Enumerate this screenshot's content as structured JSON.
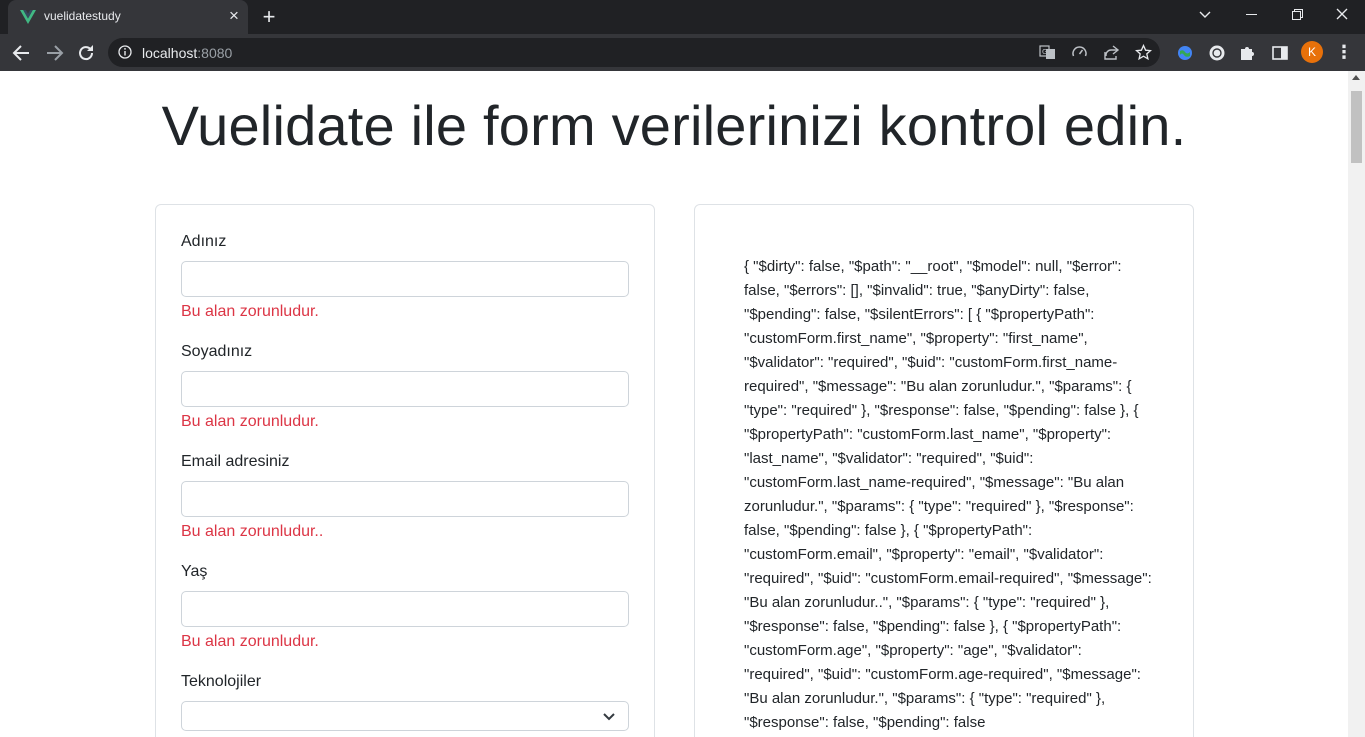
{
  "browser": {
    "tab_title": "vuelidatestudy",
    "url_host": "localhost",
    "url_port": ":8080",
    "profile_initial": "K"
  },
  "page": {
    "heading": "Vuelidate ile form verilerinizi kontrol edin."
  },
  "form": {
    "fields": [
      {
        "label": "Adınız",
        "value": "",
        "error": "Bu alan zorunludur."
      },
      {
        "label": "Soyadınız",
        "value": "",
        "error": "Bu alan zorunludur."
      },
      {
        "label": "Email adresiniz",
        "value": "",
        "error": "Bu alan zorunludur.."
      },
      {
        "label": "Yaş",
        "value": "",
        "error": "Bu alan zorunludur."
      }
    ],
    "tech_label": "Teknolojiler",
    "tech_selected": ""
  },
  "debug_output": "{ \"$dirty\": false, \"$path\": \"__root\", \"$model\": null, \"$error\": false, \"$errors\": [], \"$invalid\": true, \"$anyDirty\": false, \"$pending\": false, \"$silentErrors\": [ { \"$propertyPath\": \"customForm.first_name\", \"$property\": \"first_name\", \"$validator\": \"required\", \"$uid\": \"customForm.first_name-required\", \"$message\": \"Bu alan zorunludur.\", \"$params\": { \"type\": \"required\" }, \"$response\": false, \"$pending\": false }, { \"$propertyPath\": \"customForm.last_name\", \"$property\": \"last_name\", \"$validator\": \"required\", \"$uid\": \"customForm.last_name-required\", \"$message\": \"Bu alan zorunludur.\", \"$params\": { \"type\": \"required\" }, \"$response\": false, \"$pending\": false }, { \"$propertyPath\": \"customForm.email\", \"$property\": \"email\", \"$validator\": \"required\", \"$uid\": \"customForm.email-required\", \"$message\": \"Bu alan zorunludur..\", \"$params\": { \"type\": \"required\" }, \"$response\": false, \"$pending\": false }, { \"$propertyPath\": \"customForm.age\", \"$property\": \"age\", \"$validator\": \"required\", \"$uid\": \"customForm.age-required\", \"$message\": \"Bu alan zorunludur.\", \"$params\": { \"type\": \"required\" }, \"$response\": false, \"$pending\": false",
  "icons": {
    "tab_favicon": "vue-logo-icon",
    "tab_close": "close-icon",
    "new_tab": "plus-icon",
    "back": "arrow-left-icon",
    "forward": "arrow-right-icon",
    "reload": "reload-icon",
    "site_info": "info-icon",
    "translate": "translate-icon",
    "performance": "gauge-icon",
    "share": "share-icon",
    "bookmark": "star-icon",
    "extensions": "puzzle-icon",
    "side_panel": "side-panel-icon",
    "select_chevron": "chevron-down-icon"
  },
  "colors": {
    "error": "#dc3545",
    "vue_green": "#41b883",
    "avatar": "#e8710a"
  }
}
